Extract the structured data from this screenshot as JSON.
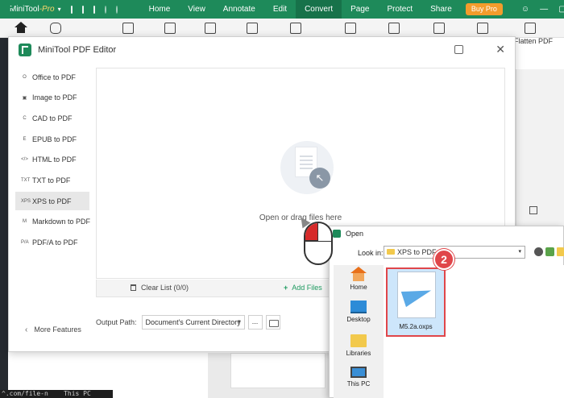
{
  "app": {
    "brand_name": "MiniTool",
    "brand_suffix": "-Pro",
    "menu": [
      "Home",
      "View",
      "Annotate",
      "Edit",
      "Convert",
      "Page",
      "Protect",
      "Share"
    ],
    "active_menu": "Convert",
    "buy_label": "Buy Pro",
    "ribbon_partial_label": "Flatten PDF"
  },
  "editor": {
    "title": "MiniTool PDF Editor",
    "sidebar": [
      {
        "icon": "O",
        "label": "Office to PDF"
      },
      {
        "icon": "▣",
        "label": "Image to PDF"
      },
      {
        "icon": "C",
        "label": "CAD to PDF"
      },
      {
        "icon": "E",
        "label": "EPUB to PDF"
      },
      {
        "icon": "</>",
        "label": "HTML to PDF"
      },
      {
        "icon": "TXT",
        "label": "TXT to PDF"
      },
      {
        "icon": "XPS",
        "label": "XPS to PDF"
      },
      {
        "icon": "M",
        "label": "Markdown to PDF"
      },
      {
        "icon": "P/A",
        "label": "PDF/A to PDF"
      }
    ],
    "active_item": "XPS to PDF",
    "more_features": "More Features",
    "drop_text": "Open or drag files here",
    "clear_list": "Clear List (0/0)",
    "add_files": "Add Files",
    "output_label": "Output Path:",
    "output_value": "Document's Current Directory",
    "more_button": "..."
  },
  "open_dialog": {
    "title": "Open",
    "look_in_label": "Look in:",
    "look_in_value": "XPS to PDF",
    "places": [
      "Home",
      "Desktop",
      "Libraries",
      "This PC"
    ],
    "files": [
      {
        "name": "M5.2a.oxps",
        "selected": true
      }
    ]
  },
  "annotation": {
    "step_number": "2",
    "accent_color": "#e0464a"
  },
  "background": {
    "terminal_text": "^.com/file-n",
    "taskbar_text": "This PC"
  },
  "colors": {
    "brand_green": "#1e8a5a",
    "buy_orange": "#f39c2c",
    "add_files_green": "#1e9a60",
    "selection_blue": "#cde6fb"
  }
}
